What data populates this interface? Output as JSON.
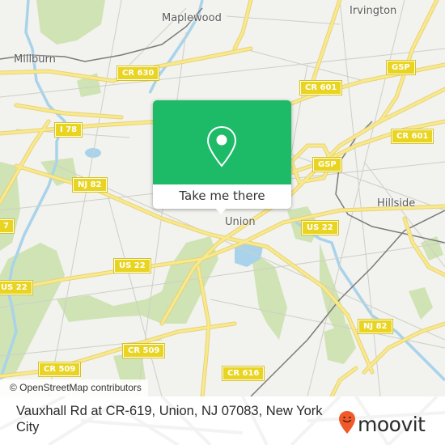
{
  "map": {
    "places": [
      {
        "id": "maplewood",
        "name": "Maplewood"
      },
      {
        "id": "irvington",
        "name": "Irvington"
      },
      {
        "id": "millburn",
        "name": "Millburn"
      },
      {
        "id": "hillside",
        "name": "Hillside"
      },
      {
        "id": "union",
        "name": "Union"
      }
    ],
    "shields": [
      {
        "id": "cr630",
        "label": "CR 630"
      },
      {
        "id": "cr601a",
        "label": "CR 601"
      },
      {
        "id": "gsp1",
        "label": "GSP"
      },
      {
        "id": "i78",
        "label": "I 78"
      },
      {
        "id": "cr601b",
        "label": "CR 601"
      },
      {
        "id": "gsp2",
        "label": "GSP"
      },
      {
        "id": "nj82a",
        "label": "NJ 82"
      },
      {
        "id": "edge7",
        "label": "7"
      },
      {
        "id": "us22a",
        "label": "US 22"
      },
      {
        "id": "us22b",
        "label": "US 22"
      },
      {
        "id": "us22c",
        "label": "US 22"
      },
      {
        "id": "nj82b",
        "label": "NJ 82"
      },
      {
        "id": "cr509a",
        "label": "CR 509"
      },
      {
        "id": "cr509b",
        "label": "CR 509"
      },
      {
        "id": "cr616",
        "label": "CR 616"
      }
    ],
    "colors": {
      "background": "#f2f2ee",
      "road_major": "#f7e27a",
      "road_minor": "#c9c9c4",
      "water": "#a9d3ea",
      "park": "#cfe3b4",
      "rail": "#777777"
    },
    "attribution": "© OpenStreetMap contributors"
  },
  "popup": {
    "icon": "map-pin-icon",
    "button_label": "Take me there",
    "color": "#1dbb68"
  },
  "footer": {
    "address": "Vauxhall Rd at CR-619, Union, NJ 07083, New York City",
    "logo_text": "moovit",
    "logo_icon": "moovit-smiley-pin-icon",
    "logo_color": "#f0592a"
  }
}
